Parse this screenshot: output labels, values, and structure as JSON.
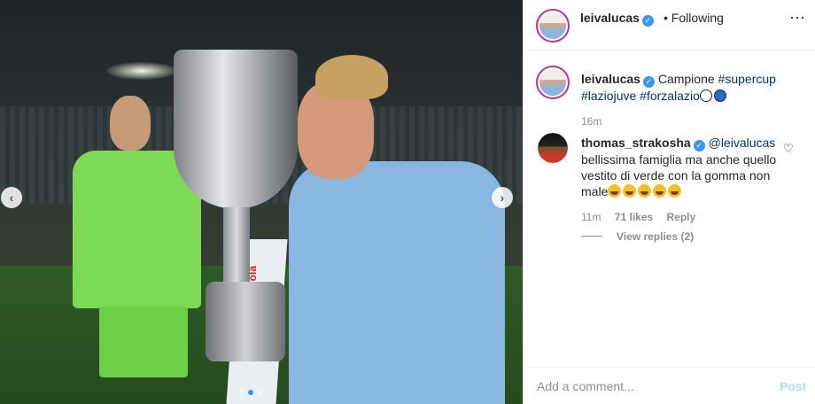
{
  "header": {
    "username": "leivalucas",
    "separator": "•",
    "follow_status": "Following",
    "more_icon": "more-horizontal-icon"
  },
  "caption": {
    "username": "leivalucas",
    "text": "Campione",
    "hashtags": [
      "#supercup",
      "#laziojuve",
      "#forzalazio"
    ],
    "time": "16m"
  },
  "comment": {
    "username": "thomas_strakosha",
    "mention": "@leivalucas",
    "text": "bellissima famiglia ma anche quello vestito di verde con la gomma non male",
    "time": "11m",
    "likes": "71 likes",
    "reply_label": "Reply",
    "view_replies": "View replies (2)"
  },
  "photo": {
    "ribbon_text": "Coca-Cola"
  },
  "footer": {
    "comment_placeholder": "Add a comment...",
    "post_label": "Post"
  },
  "colors": {
    "link_blue": "#003569",
    "accent_blue": "#3897f0",
    "post_disabled": "#b2dffc",
    "muted": "#8e8e8e"
  }
}
